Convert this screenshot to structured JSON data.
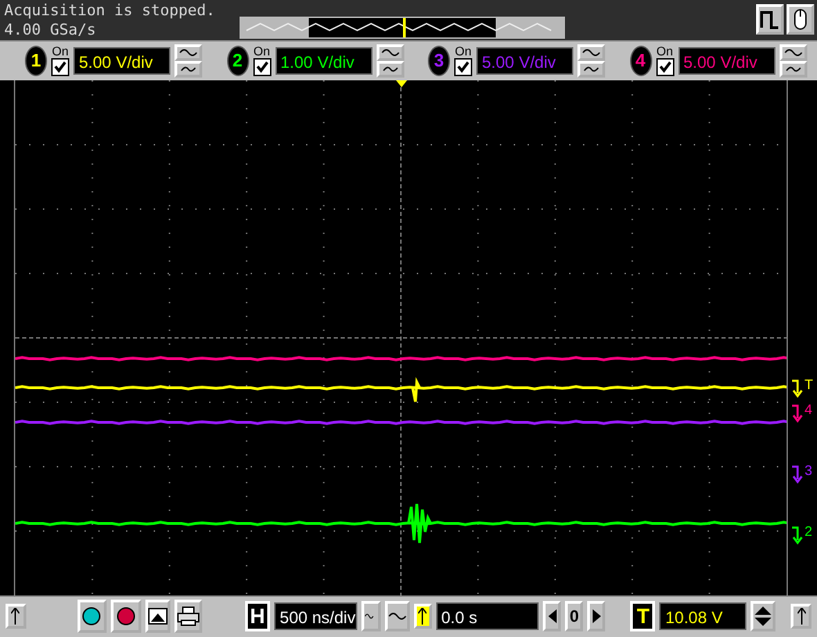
{
  "status": {
    "message": "Acquisition is stopped.",
    "sample_rate": "4.00 GSa/s"
  },
  "channels": [
    {
      "number": "1",
      "on_label": "On",
      "on": true,
      "scale": "5.00 V/div",
      "color": "#ffff00"
    },
    {
      "number": "2",
      "on_label": "On",
      "on": true,
      "scale": "1.00 V/div",
      "color": "#00ff00"
    },
    {
      "number": "3",
      "on_label": "On",
      "on": true,
      "scale": "5.00 V/div",
      "color": "#9b1bff"
    },
    {
      "number": "4",
      "on_label": "On",
      "on": true,
      "scale": "5.00 V/div",
      "color": "#ff0080"
    }
  ],
  "markers": [
    {
      "label": "T",
      "color": "#ffff00"
    },
    {
      "label": "4",
      "color": "#ff0080"
    },
    {
      "label": "3",
      "color": "#9b1bff"
    },
    {
      "label": "2",
      "color": "#00ff00"
    }
  ],
  "bottom": {
    "horizontal_label": "H",
    "timebase": "500 ns/div",
    "delay": "0.0 s",
    "center": "0",
    "trigger_label": "T",
    "trigger_level": "10.08 V"
  }
}
